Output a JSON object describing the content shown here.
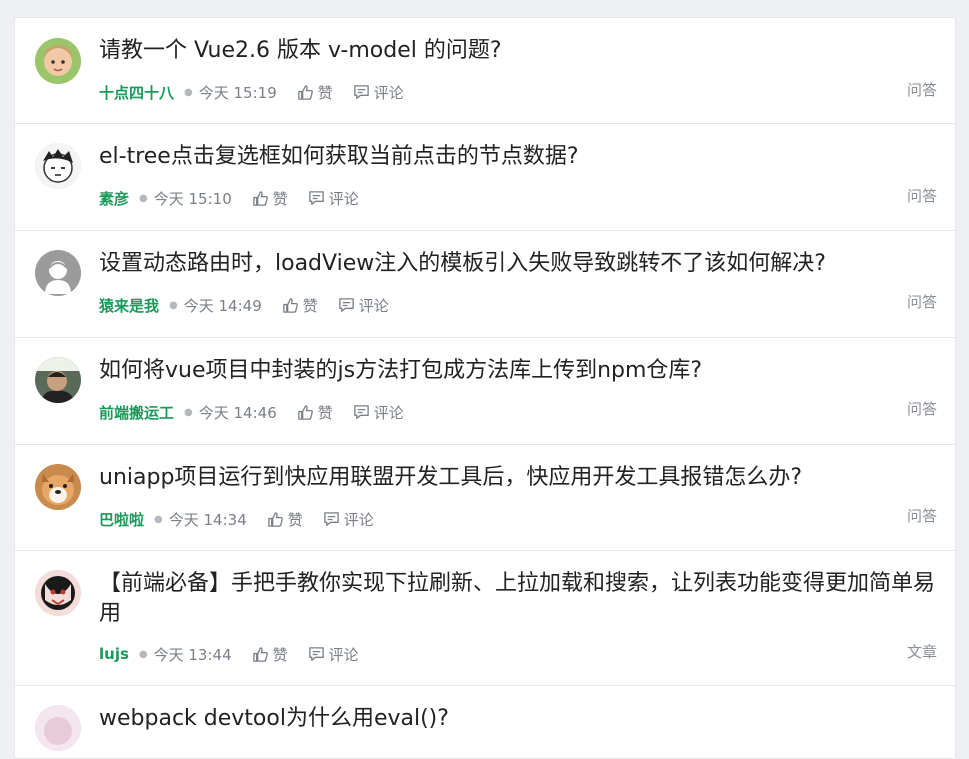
{
  "posts": [
    {
      "title": "请教一个 Vue2.6 版本 v-model 的问题?",
      "author": "十点四十八",
      "time": "今天 15:19",
      "like": "赞",
      "comment": "评论",
      "type": "问答"
    },
    {
      "title": "el-tree点击复选框如何获取当前点击的节点数据?",
      "author": "素彦",
      "time": "今天 15:10",
      "like": "赞",
      "comment": "评论",
      "type": "问答"
    },
    {
      "title": "设置动态路由时，loadView注入的模板引入失败导致跳转不了该如何解决?",
      "author": "猿来是我",
      "time": "今天 14:49",
      "like": "赞",
      "comment": "评论",
      "type": "问答"
    },
    {
      "title": "如何将vue项目中封装的js方法打包成方法库上传到npm仓库?",
      "author": "前端搬运工",
      "time": "今天 14:46",
      "like": "赞",
      "comment": "评论",
      "type": "问答"
    },
    {
      "title": "uniapp项目运行到快应用联盟开发工具后，快应用开发工具报错怎么办?",
      "author": "巴啦啦",
      "time": "今天 14:34",
      "like": "赞",
      "comment": "评论",
      "type": "问答"
    },
    {
      "title": "【前端必备】手把手教你实现下拉刷新、上拉加载和搜索，让列表功能变得更加简单易用",
      "author": "lujs",
      "time": "今天 13:44",
      "like": "赞",
      "comment": "评论",
      "type": "文章"
    },
    {
      "title": "webpack devtool为什么用eval()?",
      "author": "",
      "time": "",
      "like": "",
      "comment": "",
      "type": ""
    }
  ],
  "colors": {
    "author": "#1a9a5a",
    "title": "#222222",
    "meta": "#7a7f87"
  }
}
